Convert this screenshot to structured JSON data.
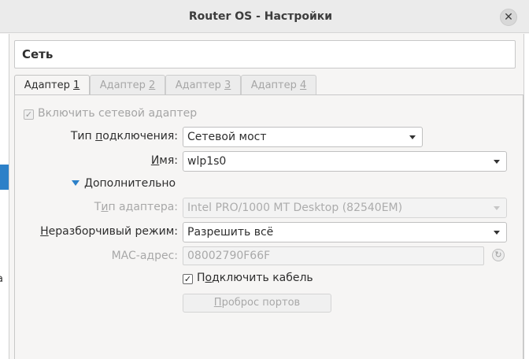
{
  "window": {
    "title": "Router OS - Настройки",
    "close_glyph": "✕"
  },
  "left_panel": {
    "cut_text": "а"
  },
  "section": {
    "title": "Сеть"
  },
  "tabs": [
    {
      "prefix": "Адаптер ",
      "accel": "1",
      "active": true
    },
    {
      "prefix": "Адаптер ",
      "accel": "2",
      "active": false
    },
    {
      "prefix": "Адаптер ",
      "accel": "3",
      "active": false
    },
    {
      "prefix": "Адаптер ",
      "accel": "4",
      "active": false
    }
  ],
  "enable_adapter": {
    "label": "Включить сетевой адаптер",
    "checked": true,
    "disabled": true
  },
  "attachment": {
    "label_pre": "Тип ",
    "label_accel": "п",
    "label_post": "одключения:",
    "value": "Сетевой мост"
  },
  "name": {
    "label_accel": "И",
    "label_post": "мя:",
    "value": "wlp1s0"
  },
  "advanced": {
    "label_accel": "Д",
    "label_post": "ополнительно"
  },
  "adapter_type": {
    "label_pre": "Т",
    "label_accel": "и",
    "label_post": "п адаптера:",
    "value": "Intel PRO/1000 MT Desktop (82540EM)"
  },
  "promisc": {
    "label_accel": "Н",
    "label_post": "еразборчивый режим:",
    "value": "Разрешить всё"
  },
  "mac": {
    "label": "MAC-адрес:",
    "value": "08002790F66F"
  },
  "cable": {
    "label_pre": "П",
    "label_accel": "о",
    "label_post": "дключить кабель",
    "checked": true
  },
  "port_forwarding": {
    "label_accel": "П",
    "label_post": "роброс портов"
  },
  "colors": {
    "accent": "#2c80c8",
    "disabled_text": "#a8a8a8"
  }
}
